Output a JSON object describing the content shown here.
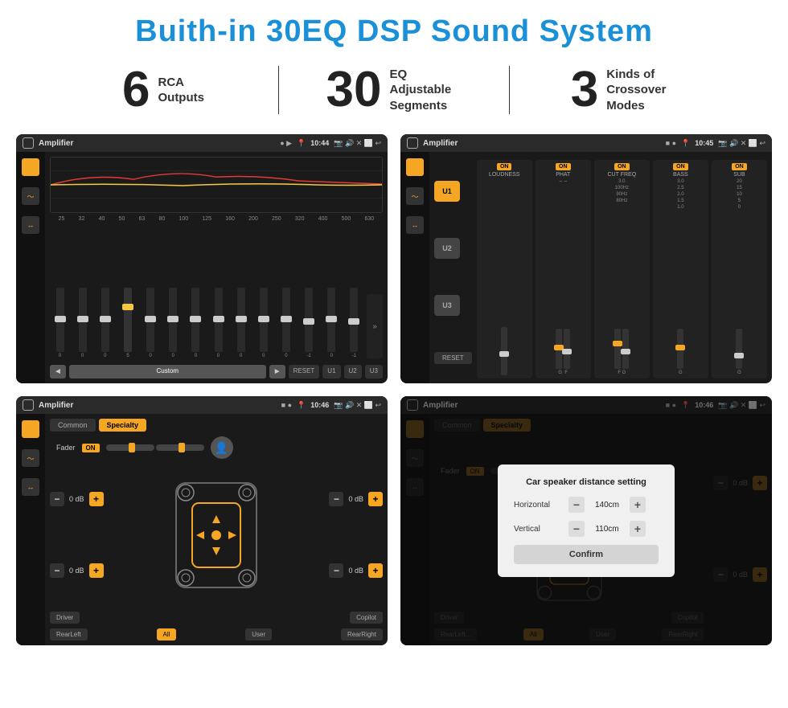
{
  "page": {
    "title": "Buith-in 30EQ DSP Sound System",
    "background": "#ffffff"
  },
  "stats": [
    {
      "number": "6",
      "text": "RCA\nOutputs"
    },
    {
      "number": "30",
      "text": "EQ Adjustable\nSegments"
    },
    {
      "number": "3",
      "text": "Kinds of\nCrossover Modes"
    }
  ],
  "screens": [
    {
      "id": "screen1",
      "title": "Amplifier",
      "time": "10:44",
      "type": "eq"
    },
    {
      "id": "screen2",
      "title": "Amplifier",
      "time": "10:45",
      "type": "amp_channels"
    },
    {
      "id": "screen3",
      "title": "Amplifier",
      "time": "10:46",
      "type": "fader"
    },
    {
      "id": "screen4",
      "title": "Amplifier",
      "time": "10:46",
      "type": "distance_dialog"
    }
  ],
  "eq": {
    "frequencies": [
      "25",
      "32",
      "40",
      "50",
      "63",
      "80",
      "100",
      "125",
      "160",
      "200",
      "250",
      "320",
      "400",
      "500",
      "630"
    ],
    "values": [
      "0",
      "0",
      "0",
      "5",
      "0",
      "0",
      "0",
      "0",
      "0",
      "0",
      "0",
      "-1",
      "0",
      "-1",
      ""
    ],
    "preset": "Custom",
    "buttons": [
      "RESET",
      "U1",
      "U2",
      "U3"
    ]
  },
  "channels": {
    "units": [
      "U1",
      "U2",
      "U3"
    ],
    "strips": [
      "LOUDNESS",
      "PHAT",
      "CUT FREQ",
      "BASS",
      "SUB"
    ]
  },
  "fader": {
    "tabs": [
      "Common",
      "Specialty"
    ],
    "active_tab": "Specialty",
    "fader_label": "Fader",
    "fader_on": "ON",
    "vol_rows": [
      {
        "label": "",
        "value": "0 dB"
      },
      {
        "label": "",
        "value": "0 dB"
      },
      {
        "label": "",
        "value": "0 dB"
      },
      {
        "label": "",
        "value": "0 dB"
      }
    ],
    "bottom_buttons": [
      "Driver",
      "",
      "Copilot",
      "RearLeft",
      "All",
      "User",
      "RearRight"
    ]
  },
  "dialog": {
    "title": "Car speaker distance setting",
    "rows": [
      {
        "label": "Horizontal",
        "value": "140cm"
      },
      {
        "label": "Vertical",
        "value": "110cm"
      }
    ],
    "confirm_label": "Confirm",
    "vol_rows": [
      {
        "value": "0 dB"
      },
      {
        "value": "0 dB"
      }
    ]
  }
}
